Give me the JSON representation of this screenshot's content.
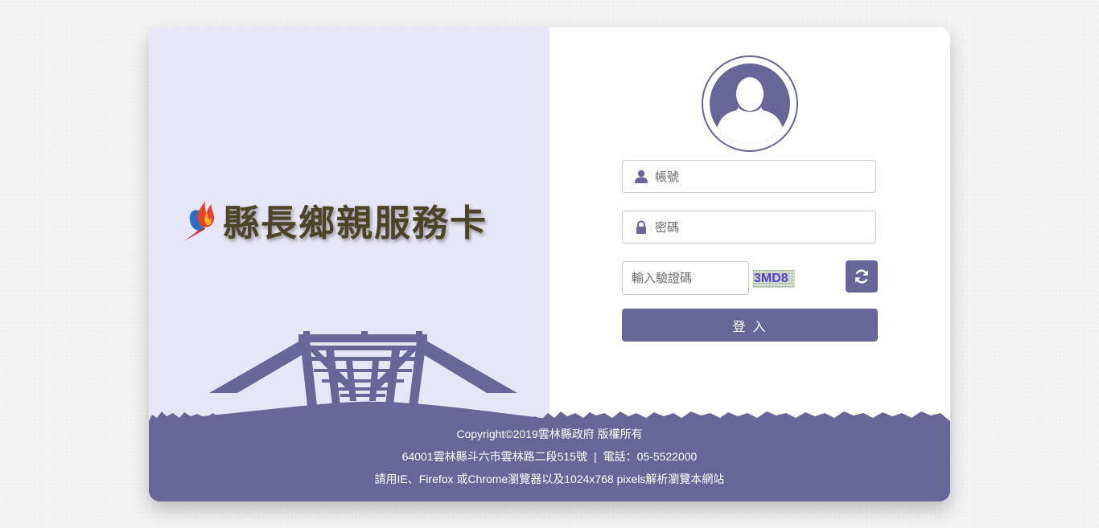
{
  "brand": {
    "title": "縣長鄉親服務卡"
  },
  "login": {
    "account_placeholder": "帳號",
    "password_placeholder": "密碼",
    "captcha_placeholder": "輸入驗證碼",
    "captcha_code": "3MD8",
    "submit_label": "登 入"
  },
  "footer": {
    "copyright": "Copyright©2019雲林縣政府 版權所有",
    "address": "64001雲林縣斗六市雲林路二段515號",
    "separator": "|",
    "phone": "電話：05-5522000",
    "browser_note": "請用IE、Firefox 或Chrome瀏覽器以及1024x768 pixels解析瀏覽本網站"
  },
  "colors": {
    "accent": "#686598",
    "left_panel_bg": "#e7e6f6",
    "brand_text": "#4c4427",
    "captcha_text": "#5b3ed6"
  },
  "icons": {
    "avatar": "user-avatar-icon",
    "account": "user-icon",
    "password": "lock-icon",
    "refresh": "refresh-icon",
    "logo": "flame-logo-icon"
  }
}
